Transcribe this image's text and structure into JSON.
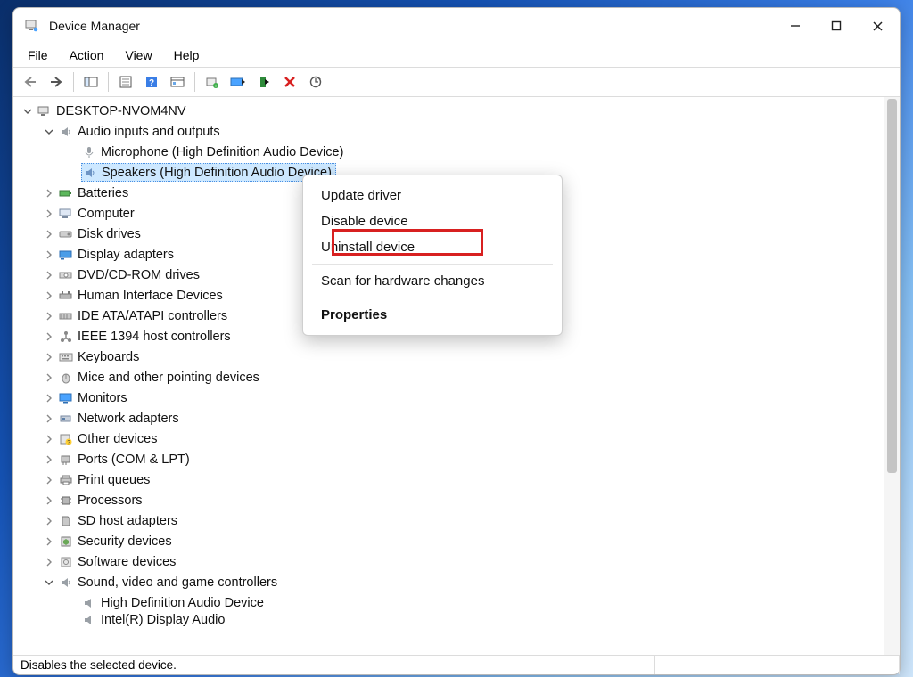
{
  "window": {
    "title": "Device Manager"
  },
  "menu": {
    "file": "File",
    "action": "Action",
    "view": "View",
    "help": "Help"
  },
  "tree": {
    "root": "DESKTOP-NVOM4NV",
    "audio": {
      "label": "Audio inputs and outputs",
      "mic": "Microphone (High Definition Audio Device)",
      "speakers": "Speakers (High Definition Audio Device)"
    },
    "batteries": "Batteries",
    "computer": "Computer",
    "disk": "Disk drives",
    "display": "Display adapters",
    "dvd": "DVD/CD-ROM drives",
    "hid": "Human Interface Devices",
    "ide": "IDE ATA/ATAPI controllers",
    "ieee": "IEEE 1394 host controllers",
    "keyboards": "Keyboards",
    "mice": "Mice and other pointing devices",
    "monitors": "Monitors",
    "network": "Network adapters",
    "other": "Other devices",
    "ports": "Ports (COM & LPT)",
    "print": "Print queues",
    "processors": "Processors",
    "sdhost": "SD host adapters",
    "security": "Security devices",
    "software": "Software devices",
    "sound": {
      "label": "Sound, video and game controllers",
      "hd": "High Definition Audio Device",
      "intel": "Intel(R) Display Audio"
    }
  },
  "context": {
    "update": "Update driver",
    "disable": "Disable device",
    "uninstall": "Uninstall device",
    "scan": "Scan for hardware changes",
    "properties": "Properties"
  },
  "status": {
    "text": "Disables the selected device."
  }
}
